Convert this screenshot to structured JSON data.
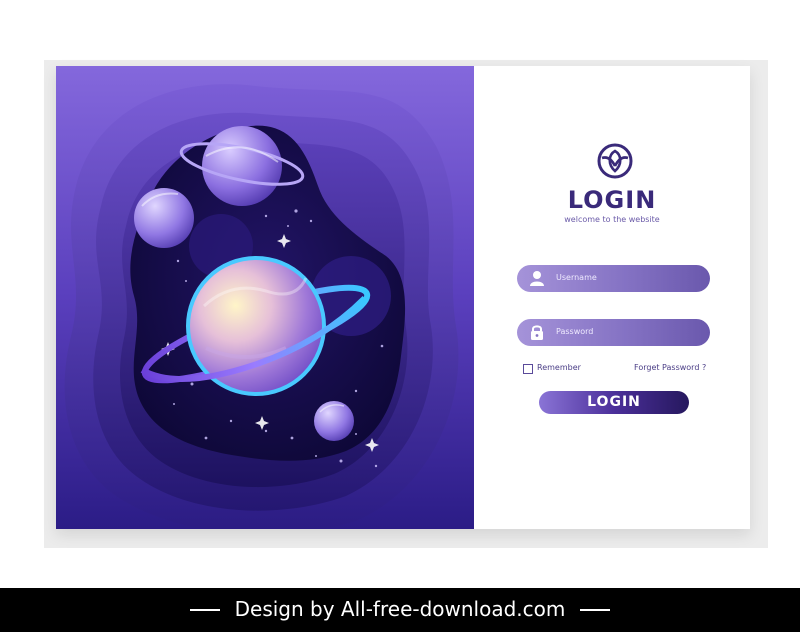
{
  "form": {
    "title": "LOGIN",
    "subtitle": "welcome to the website",
    "username_placeholder": "Username",
    "password_placeholder": "Password",
    "remember_label": "Remember",
    "forgot_label": "Forget Password ?",
    "login_button": "LOGIN",
    "logo_icon": "leaf-circle-logo-icon",
    "user_icon": "user-icon",
    "lock_icon": "lock-icon"
  },
  "footer": {
    "credit": "Design by All-free-download.com"
  },
  "colors": {
    "brand": "#3a2a7a",
    "field": "#8573c4",
    "art_bg": "#6a4fd0"
  }
}
